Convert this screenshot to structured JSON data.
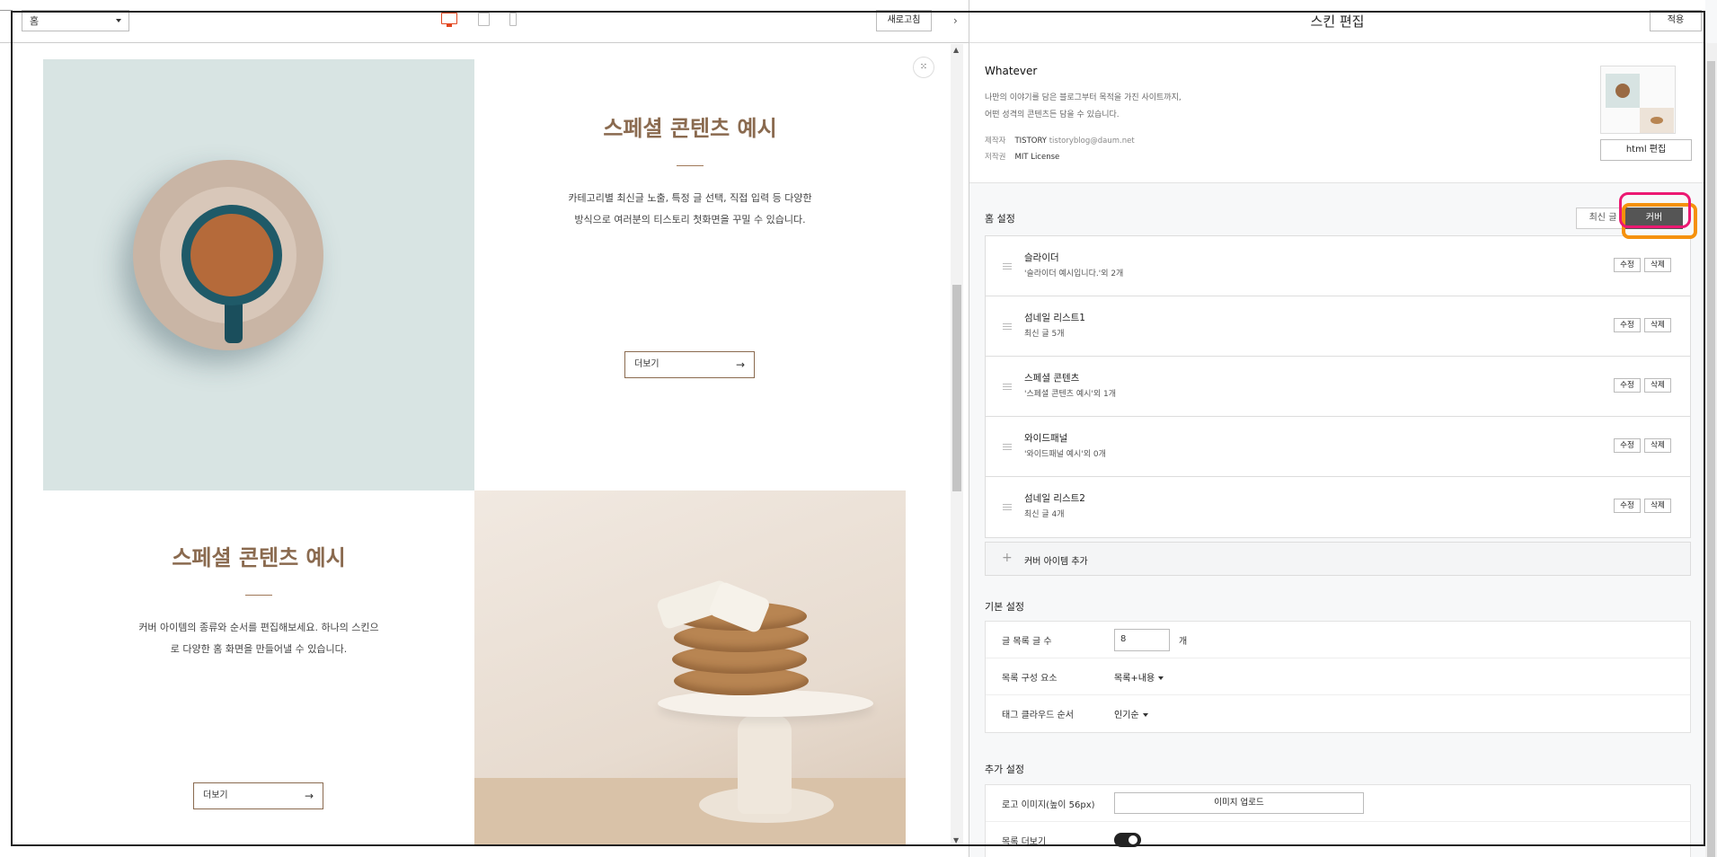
{
  "toolbar": {
    "page_select": "홈",
    "refresh_label": "새로고침",
    "collapse_glyph": "›"
  },
  "preview": {
    "sections": [
      {
        "title": "스페셜 콘텐츠 예시",
        "desc_lines": [
          "카테고리별 최신글 노출, 특정 글 선택, 직접 입력 등 다양한",
          "방식으로 여러분의 티스토리 첫화면을 꾸밀 수 있습니다."
        ],
        "button": "더보기"
      },
      {
        "title": "스페셜 콘텐츠 예시",
        "desc_lines": [
          "커버 아이템의 종류와 순서를 편집해보세요. 하나의 스킨으",
          "로 다양한 홈 화면을 만들어낼 수 있습니다."
        ],
        "button": "더보기"
      }
    ],
    "arrow_glyph": "→"
  },
  "panel": {
    "title": "스킨 편집",
    "apply_label": "적용",
    "skin": {
      "name": "Whatever",
      "desc_lines": [
        "나만의 이야기를 담은 블로그부터 목적을 가진 사이트까지,",
        "어떤 성격의 콘텐츠든 담을 수 있습니다."
      ],
      "maker_label": "제작자",
      "maker_name": "TISTORY",
      "maker_email": "tistoryblog@daum.net",
      "license_label": "저작권",
      "license_value": "MIT License",
      "html_edit_label": "html 편집"
    },
    "home": {
      "section_title": "홈 설정",
      "tab_recent": "최신 글",
      "tab_cover": "커버",
      "edit_label": "수정",
      "delete_label": "삭제",
      "items": [
        {
          "title": "슬라이더",
          "sub": "'슬라이더 예시입니다.'외 2개"
        },
        {
          "title": "섬네일 리스트1",
          "sub": "최신 글 5개"
        },
        {
          "title": "스페셜 콘텐츠",
          "sub": "'스페셜 콘텐츠 예시'외 1개"
        },
        {
          "title": "와이드패널",
          "sub": "'와이드패널 예시'외 0개"
        },
        {
          "title": "섬네일 리스트2",
          "sub": "최신 글 4개"
        }
      ],
      "add_label": "커버 아이템 추가"
    },
    "basic": {
      "section_title": "기본 설정",
      "post_count_label": "글 목록 글 수",
      "post_count_value": "8",
      "post_count_unit": "개",
      "list_comp_label": "목록 구성 요소",
      "list_comp_value": "목록+내용",
      "tag_order_label": "태그 클라우드 순서",
      "tag_order_value": "인기순"
    },
    "extra": {
      "section_title": "추가 설정",
      "logo_label": "로고 이미지(높이 56px)",
      "upload_label": "이미지 업로드",
      "more_label": "목록 더보기",
      "more_toggle_on": true
    }
  },
  "colors": {
    "accent_device": "#e2451e",
    "title_brown": "#8a6a4f",
    "cover_tab_bg": "#555555",
    "highlight_magenta": "#ec1872",
    "highlight_orange": "#f5910c"
  }
}
